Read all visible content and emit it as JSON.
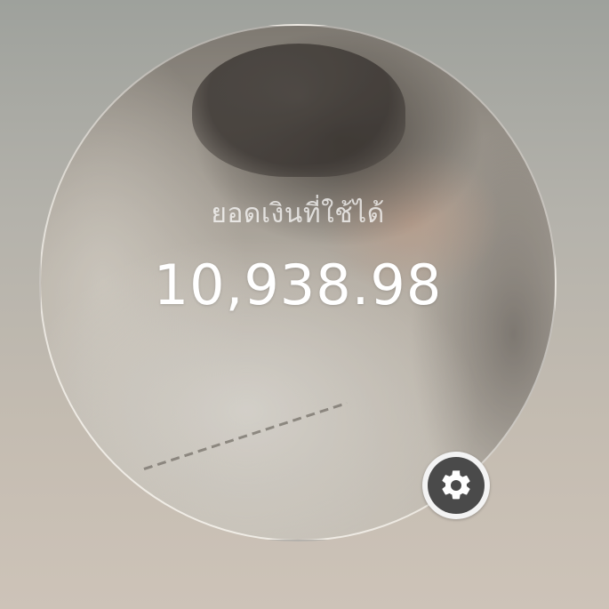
{
  "balance": {
    "label": "ยอดเงินที่ใช้ได้",
    "amount": "10,938.98"
  },
  "settings": {
    "icon": "gear-icon"
  },
  "colors": {
    "text_primary": "#ffffff",
    "settings_bg": "#4a4a4a",
    "settings_ring": "#f3f3f3"
  }
}
